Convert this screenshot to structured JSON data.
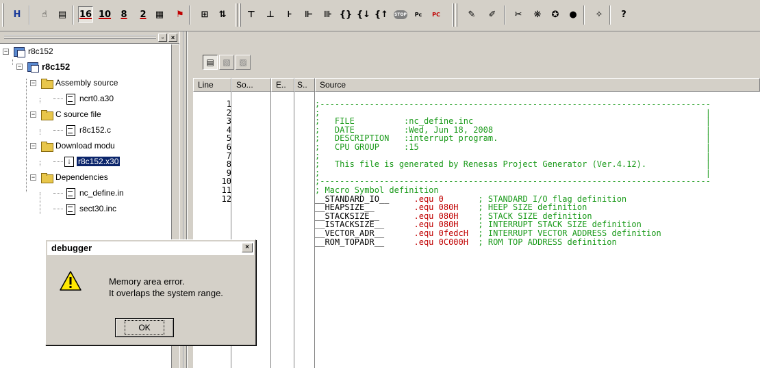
{
  "toolbar": {
    "radix_16": "16",
    "radix_10": "10",
    "radix_8": "8",
    "radix_2": "2",
    "step_in_pc": "Pc",
    "step_pc": "PC",
    "stop": "STOP"
  },
  "workspace": {
    "tree": [
      {
        "label": "r8c152"
      },
      {
        "label": "r8c152"
      },
      {
        "label": "Assembly source"
      },
      {
        "label": "ncrt0.a30"
      },
      {
        "label": "C source file"
      },
      {
        "label": "r8c152.c"
      },
      {
        "label": "Download modu"
      },
      {
        "label": "r8c152.x30"
      },
      {
        "label": "Dependencies"
      },
      {
        "label": "nc_define.in"
      },
      {
        "label": "sect30.inc"
      }
    ]
  },
  "editor": {
    "columns": [
      "Line",
      "So...",
      "E..",
      "S..",
      "Source"
    ],
    "line_numbers": [
      "1",
      "2",
      "3",
      "4",
      "5",
      "6",
      "7",
      "8",
      "9",
      "10",
      "11",
      "12"
    ],
    "source_lines": [
      ";-------------------------------------------------------------------------------",
      ";                                                                              |",
      ";   FILE          :nc_define.inc                                               |",
      ";   DATE          :Wed, Jun 18, 2008                                           |",
      ";   DESCRIPTION   :interrupt program.                                          |",
      ";   CPU GROUP     :15                                                          |",
      ";                                                                              |",
      ";   This file is generated by Renesas Project Generator (Ver.4.12).            |",
      ";                                                                              |",
      ";-------------------------------------------------------------------------------",
      "; Macro Symbol definition"
    ],
    "macros": [
      {
        "sym": "__STANDARD_IO__",
        "dir": ".equ",
        "val": "0",
        "cmt": "; STANDARD I/O flag definition"
      },
      {
        "sym": "__HEAPSIZE__",
        "dir": ".equ",
        "val": "080H",
        "cmt": "; HEEP SIZE definition"
      },
      {
        "sym": "__STACKSIZE__",
        "dir": ".equ",
        "val": "080H",
        "cmt": "; STACK SIZE definition"
      },
      {
        "sym": "__ISTACKSIZE__",
        "dir": ".equ",
        "val": "080H",
        "cmt": "; INTERRUPT STACK SIZE definition"
      },
      {
        "sym": "__VECTOR_ADR__",
        "dir": ".equ",
        "val": "0fedcH",
        "cmt": "; INTERRUPT VECTOR ADDRESS definition"
      },
      {
        "sym": "__ROM_TOPADR__",
        "dir": ".equ",
        "val": "0C000H",
        "cmt": "; ROM TOP ADDRESS definition"
      }
    ]
  },
  "dialog": {
    "title": "debugger",
    "message_line1": "Memory area error.",
    "message_line2": "It overlaps the system range.",
    "ok_label": "OK",
    "close_glyph": "×"
  }
}
